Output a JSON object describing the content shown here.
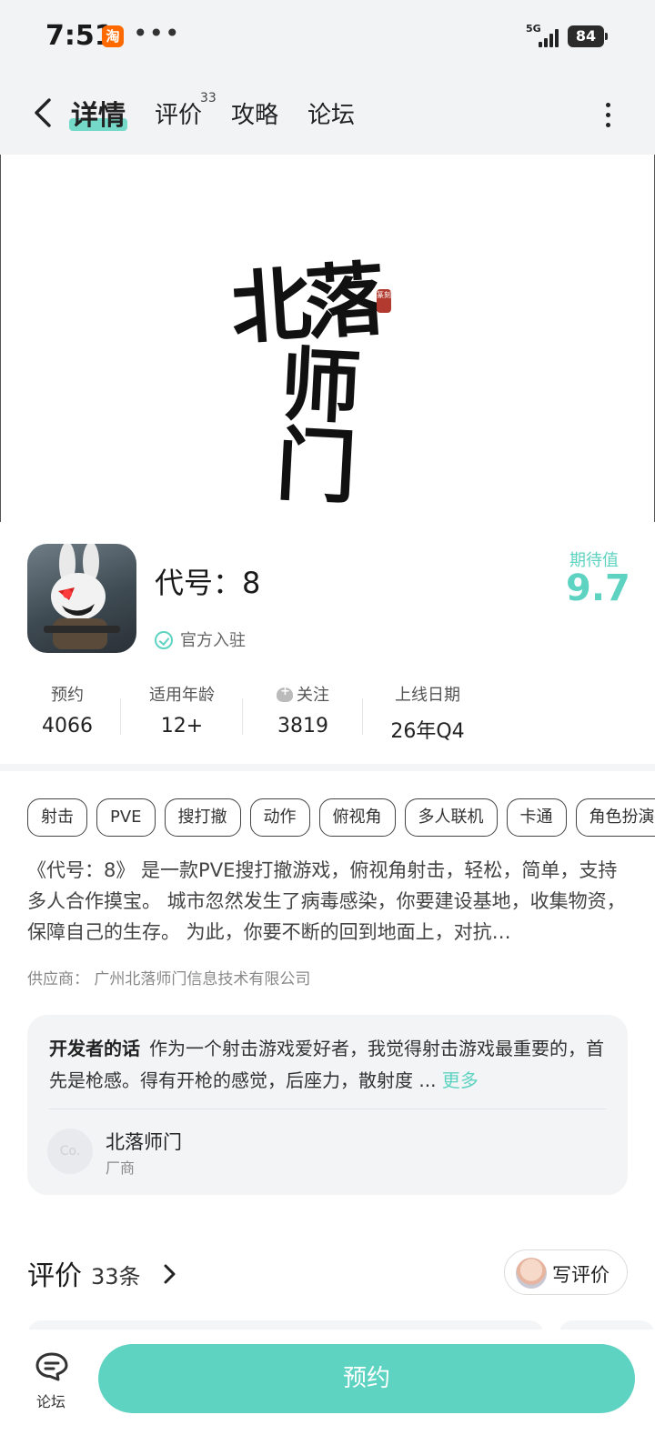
{
  "status_bar": {
    "time": "7:51",
    "app_badge": "淘",
    "more_dots": "•••",
    "network": "5G",
    "battery": "84"
  },
  "nav": {
    "tabs": [
      {
        "label": "详情",
        "active": true
      },
      {
        "label": "评价",
        "badge": "33"
      },
      {
        "label": "攻略"
      },
      {
        "label": "论坛"
      }
    ]
  },
  "banner": {
    "logo_line1": "北落",
    "logo_line2": "师门",
    "seal_text": "篆刻"
  },
  "app": {
    "title": "代号：8",
    "official_label": "官方入驻",
    "expect_label": "期待值",
    "expect_score": "9.7"
  },
  "stats": [
    {
      "label": "预约",
      "value": "4066"
    },
    {
      "label": "适用年龄",
      "value": "12+"
    },
    {
      "label": "关注",
      "value": "3819"
    },
    {
      "label": "上线日期",
      "value": "26年Q4"
    }
  ],
  "tags": [
    "射击",
    "PVE",
    "搜打撤",
    "动作",
    "俯视角",
    "多人联机",
    "卡通",
    "角色扮演"
  ],
  "description": "《代号：8》 是一款PVE搜打撤游戏，俯视角射击，轻松，简单，支持多人合作摸宝。 城市忽然发生了病毒感染，你要建设基地，收集物资，保障自己的生存。 为此，你要不断的回到地面上，对抗…",
  "supplier": "供应商：  广州北落师门信息技术有限公司",
  "developer": {
    "heading": "开发者的话",
    "text": "作为一个射击游戏爱好者，我觉得射击游戏最重要的，首先是枪感。得有开枪的感觉，后座力，散射度 ...",
    "more": "更多",
    "avatar_text": "Co.",
    "name": "北落师门",
    "role": "厂商"
  },
  "reviews": {
    "title": "评价",
    "count": "33条",
    "write_label": "写评价"
  },
  "bottom": {
    "forum_label": "论坛",
    "reserve_label": "预约"
  },
  "colors": {
    "accent": "#5fd3c2",
    "background_header": "#f2f3f5"
  }
}
